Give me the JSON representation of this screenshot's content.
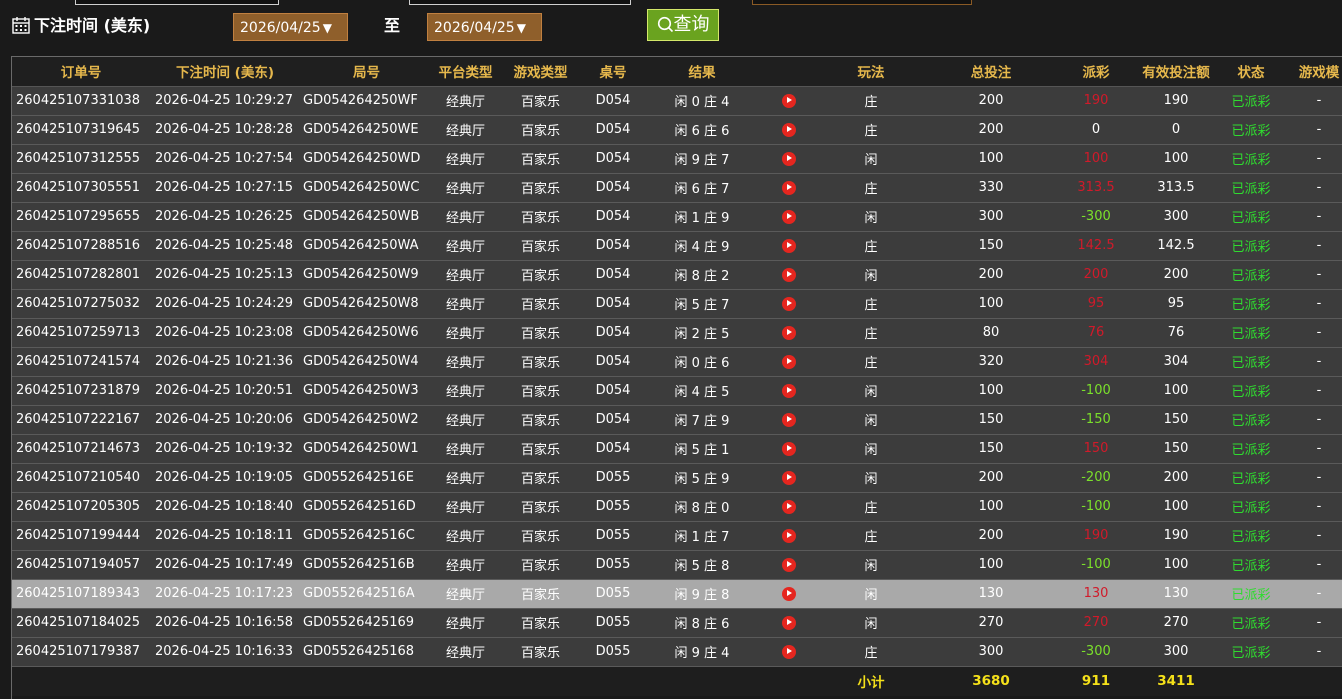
{
  "filter": {
    "label": "下注时间 (美东)",
    "start_date": "2026/04/25",
    "to": "至",
    "end_date": "2026/04/25",
    "dropdown_arrow": "▼",
    "query_label": "查询"
  },
  "table": {
    "headers": [
      "订单号",
      "下注时间 (美东)",
      "局号",
      "平台类型",
      "游戏类型",
      "桌号",
      "结果",
      "",
      "玩法",
      "总投注",
      "派彩",
      "有效投注额",
      "状态",
      "游戏模"
    ],
    "rows": [
      {
        "order": "260425107331038",
        "time": "2026-04-25 10:29:27",
        "round": "GD054264250WF",
        "platform": "经典厅",
        "game": "百家乐",
        "table": "D054",
        "result": "闲 0 庄 4",
        "play": "庄",
        "bet": "200",
        "payout": "190",
        "payout_color": "red",
        "valid": "190",
        "status": "已派彩",
        "mode": "-"
      },
      {
        "order": "260425107319645",
        "time": "2026-04-25 10:28:28",
        "round": "GD054264250WE",
        "platform": "经典厅",
        "game": "百家乐",
        "table": "D054",
        "result": "闲 6 庄 6",
        "play": "庄",
        "bet": "200",
        "payout": "0",
        "payout_color": "white",
        "valid": "0",
        "status": "已派彩",
        "mode": "-"
      },
      {
        "order": "260425107312555",
        "time": "2026-04-25 10:27:54",
        "round": "GD054264250WD",
        "platform": "经典厅",
        "game": "百家乐",
        "table": "D054",
        "result": "闲 9 庄 7",
        "play": "闲",
        "bet": "100",
        "payout": "100",
        "payout_color": "red",
        "valid": "100",
        "status": "已派彩",
        "mode": "-"
      },
      {
        "order": "260425107305551",
        "time": "2026-04-25 10:27:15",
        "round": "GD054264250WC",
        "platform": "经典厅",
        "game": "百家乐",
        "table": "D054",
        "result": "闲 6 庄 7",
        "play": "庄",
        "bet": "330",
        "payout": "313.5",
        "payout_color": "red",
        "valid": "313.5",
        "status": "已派彩",
        "mode": "-"
      },
      {
        "order": "260425107295655",
        "time": "2026-04-25 10:26:25",
        "round": "GD054264250WB",
        "platform": "经典厅",
        "game": "百家乐",
        "table": "D054",
        "result": "闲 1 庄 9",
        "play": "闲",
        "bet": "300",
        "payout": "-300",
        "payout_color": "green",
        "valid": "300",
        "status": "已派彩",
        "mode": "-"
      },
      {
        "order": "260425107288516",
        "time": "2026-04-25 10:25:48",
        "round": "GD054264250WA",
        "platform": "经典厅",
        "game": "百家乐",
        "table": "D054",
        "result": "闲 4 庄 9",
        "play": "庄",
        "bet": "150",
        "payout": "142.5",
        "payout_color": "red",
        "valid": "142.5",
        "status": "已派彩",
        "mode": "-"
      },
      {
        "order": "260425107282801",
        "time": "2026-04-25 10:25:13",
        "round": "GD054264250W9",
        "platform": "经典厅",
        "game": "百家乐",
        "table": "D054",
        "result": "闲 8 庄 2",
        "play": "闲",
        "bet": "200",
        "payout": "200",
        "payout_color": "red",
        "valid": "200",
        "status": "已派彩",
        "mode": "-"
      },
      {
        "order": "260425107275032",
        "time": "2026-04-25 10:24:29",
        "round": "GD054264250W8",
        "platform": "经典厅",
        "game": "百家乐",
        "table": "D054",
        "result": "闲 5 庄 7",
        "play": "庄",
        "bet": "100",
        "payout": "95",
        "payout_color": "red",
        "valid": "95",
        "status": "已派彩",
        "mode": "-"
      },
      {
        "order": "260425107259713",
        "time": "2026-04-25 10:23:08",
        "round": "GD054264250W6",
        "platform": "经典厅",
        "game": "百家乐",
        "table": "D054",
        "result": "闲 2 庄 5",
        "play": "庄",
        "bet": "80",
        "payout": "76",
        "payout_color": "red",
        "valid": "76",
        "status": "已派彩",
        "mode": "-"
      },
      {
        "order": "260425107241574",
        "time": "2026-04-25 10:21:36",
        "round": "GD054264250W4",
        "platform": "经典厅",
        "game": "百家乐",
        "table": "D054",
        "result": "闲 0 庄 6",
        "play": "庄",
        "bet": "320",
        "payout": "304",
        "payout_color": "red",
        "valid": "304",
        "status": "已派彩",
        "mode": "-"
      },
      {
        "order": "260425107231879",
        "time": "2026-04-25 10:20:51",
        "round": "GD054264250W3",
        "platform": "经典厅",
        "game": "百家乐",
        "table": "D054",
        "result": "闲 4 庄 5",
        "play": "闲",
        "bet": "100",
        "payout": "-100",
        "payout_color": "green",
        "valid": "100",
        "status": "已派彩",
        "mode": "-"
      },
      {
        "order": "260425107222167",
        "time": "2026-04-25 10:20:06",
        "round": "GD054264250W2",
        "platform": "经典厅",
        "game": "百家乐",
        "table": "D054",
        "result": "闲 7 庄 9",
        "play": "闲",
        "bet": "150",
        "payout": "-150",
        "payout_color": "green",
        "valid": "150",
        "status": "已派彩",
        "mode": "-"
      },
      {
        "order": "260425107214673",
        "time": "2026-04-25 10:19:32",
        "round": "GD054264250W1",
        "platform": "经典厅",
        "game": "百家乐",
        "table": "D054",
        "result": "闲 5 庄 1",
        "play": "闲",
        "bet": "150",
        "payout": "150",
        "payout_color": "red",
        "valid": "150",
        "status": "已派彩",
        "mode": "-"
      },
      {
        "order": "260425107210540",
        "time": "2026-04-25 10:19:05",
        "round": "GD0552642516E",
        "platform": "经典厅",
        "game": "百家乐",
        "table": "D055",
        "result": "闲 5 庄 9",
        "play": "闲",
        "bet": "200",
        "payout": "-200",
        "payout_color": "green",
        "valid": "200",
        "status": "已派彩",
        "mode": "-"
      },
      {
        "order": "260425107205305",
        "time": "2026-04-25 10:18:40",
        "round": "GD0552642516D",
        "platform": "经典厅",
        "game": "百家乐",
        "table": "D055",
        "result": "闲 8 庄 0",
        "play": "庄",
        "bet": "100",
        "payout": "-100",
        "payout_color": "green",
        "valid": "100",
        "status": "已派彩",
        "mode": "-"
      },
      {
        "order": "260425107199444",
        "time": "2026-04-25 10:18:11",
        "round": "GD0552642516C",
        "platform": "经典厅",
        "game": "百家乐",
        "table": "D055",
        "result": "闲 1 庄 7",
        "play": "庄",
        "bet": "200",
        "payout": "190",
        "payout_color": "red",
        "valid": "190",
        "status": "已派彩",
        "mode": "-"
      },
      {
        "order": "260425107194057",
        "time": "2026-04-25 10:17:49",
        "round": "GD0552642516B",
        "platform": "经典厅",
        "game": "百家乐",
        "table": "D055",
        "result": "闲 5 庄 8",
        "play": "闲",
        "bet": "100",
        "payout": "-100",
        "payout_color": "green",
        "valid": "100",
        "status": "已派彩",
        "mode": "-"
      },
      {
        "order": "260425107189343",
        "time": "2026-04-25 10:17:23",
        "round": "GD0552642516A",
        "platform": "经典厅",
        "game": "百家乐",
        "table": "D055",
        "result": "闲 9 庄 8",
        "play": "闲",
        "bet": "130",
        "payout": "130",
        "payout_color": "red",
        "valid": "130",
        "status": "已派彩",
        "mode": "-",
        "highlighted": true
      },
      {
        "order": "260425107184025",
        "time": "2026-04-25 10:16:58",
        "round": "GD05526425169",
        "platform": "经典厅",
        "game": "百家乐",
        "table": "D055",
        "result": "闲 8 庄 6",
        "play": "闲",
        "bet": "270",
        "payout": "270",
        "payout_color": "red",
        "valid": "270",
        "status": "已派彩",
        "mode": "-"
      },
      {
        "order": "260425107179387",
        "time": "2026-04-25 10:16:33",
        "round": "GD05526425168",
        "platform": "经典厅",
        "game": "百家乐",
        "table": "D055",
        "result": "闲 9 庄 4",
        "play": "庄",
        "bet": "300",
        "payout": "-300",
        "payout_color": "green",
        "valid": "300",
        "status": "已派彩",
        "mode": "-"
      }
    ],
    "subtotal": {
      "label": "小计",
      "bet": "3680",
      "payout": "911",
      "valid": "3411"
    }
  },
  "colors": {
    "header_text": "#e6b84c",
    "payout_win": "#d11a2a",
    "payout_loss": "#7be02b",
    "status": "#2fdc2f",
    "subtotal": "#f5e11a",
    "query_button": "#6aa31f",
    "date_box": "#8f5f2b",
    "play_icon": "#e5261f"
  },
  "icons": {
    "calendar": "calendar-icon",
    "search": "search-icon",
    "play": "play-icon"
  }
}
